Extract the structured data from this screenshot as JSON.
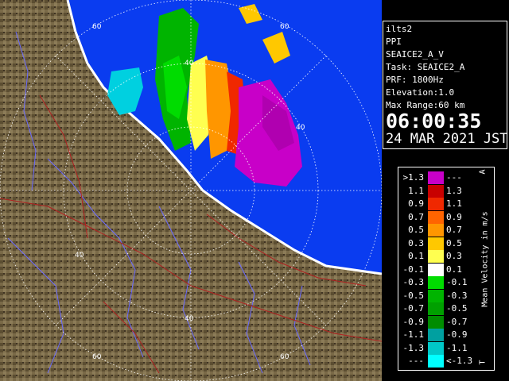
{
  "colors": {
    "sea": "#0a3cf0",
    "land": "#7a6a48",
    "land_dark": "#4a3e28",
    "range_ring": "#ffffff",
    "river": "#6a6aff",
    "road": "#b02020"
  },
  "radar": {
    "ring_labels": [
      "60",
      "40",
      "40",
      "40",
      "40",
      "60",
      "60",
      "60"
    ]
  },
  "info": {
    "site": "ilts2",
    "product": "PPI",
    "scan": "SEAICE2_A_V",
    "task": "Task: SEAICE2_A",
    "prf": "PRF: 1800Hz",
    "elevation": "Elevation:1.0",
    "max_range": "Max Range:60 km",
    "time": "06:00:35",
    "date": "24 MAR 2021 JST"
  },
  "legend": {
    "title": "Mean Velocity in m/s",
    "tick_top": "A",
    "tick_bottom": "T",
    "rows": [
      {
        "lo": ">1.3",
        "hi": "---",
        "color": "#c800c8"
      },
      {
        "lo": "1.1",
        "hi": "1.3",
        "color": "#c80000"
      },
      {
        "lo": "0.9",
        "hi": "1.1",
        "color": "#f02800"
      },
      {
        "lo": "0.7",
        "hi": "0.9",
        "color": "#ff6400"
      },
      {
        "lo": "0.5",
        "hi": "0.7",
        "color": "#ff9600"
      },
      {
        "lo": "0.3",
        "hi": "0.5",
        "color": "#ffc800"
      },
      {
        "lo": "0.1",
        "hi": "0.3",
        "color": "#ffff50"
      },
      {
        "lo": "-0.1",
        "hi": "0.1",
        "color": "#ffffff"
      },
      {
        "lo": "-0.3",
        "hi": "-0.1",
        "color": "#00dc00"
      },
      {
        "lo": "-0.5",
        "hi": "-0.3",
        "color": "#00b400"
      },
      {
        "lo": "-0.7",
        "hi": "-0.5",
        "color": "#00a000"
      },
      {
        "lo": "-0.9",
        "hi": "-0.7",
        "color": "#008c00"
      },
      {
        "lo": "-1.1",
        "hi": "-0.9",
        "color": "#00a0a0"
      },
      {
        "lo": "-1.3",
        "hi": "-1.1",
        "color": "#00c8c8"
      },
      {
        "lo": "---",
        "hi": "<-1.3",
        "color": "#00ffff"
      }
    ]
  }
}
